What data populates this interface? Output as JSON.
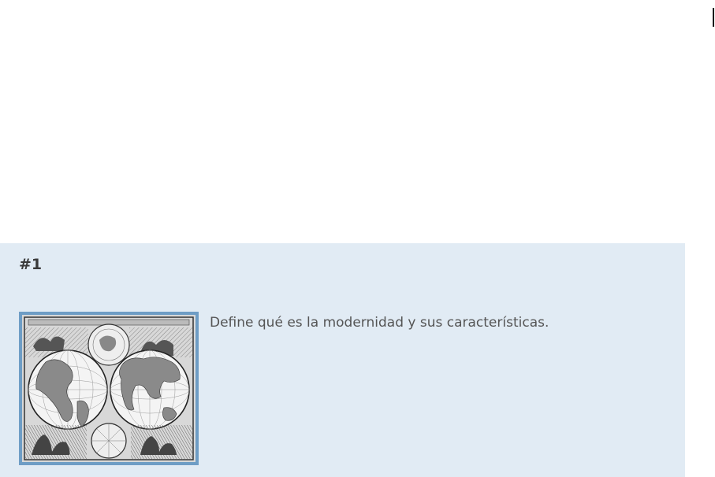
{
  "question": {
    "number": "#1",
    "text": "Define qué es la modernidad y sus características.",
    "image": {
      "icon": "world-map-engraving-icon",
      "frame_color": "#6e9dc5"
    }
  },
  "colors": {
    "card_background": "#e1ebf4",
    "text": "#555555",
    "heading": "#3a3a3a"
  }
}
